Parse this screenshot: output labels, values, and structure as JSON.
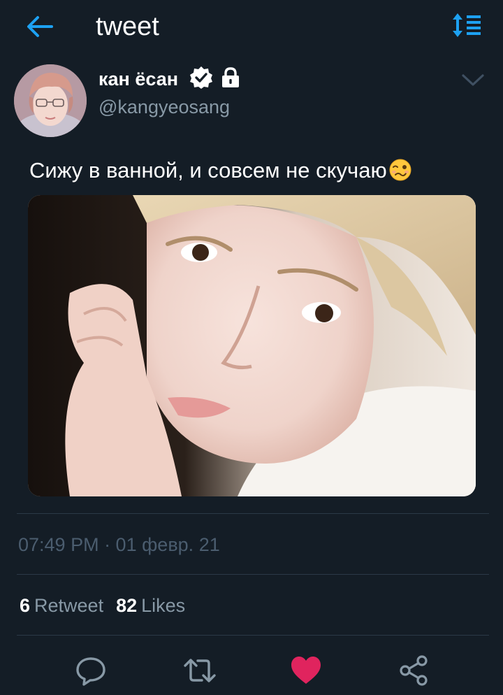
{
  "header": {
    "title": "tweet",
    "back_icon": "arrow-left-icon",
    "sort_icon": "sort-lines-icon",
    "accent": "#1da1f2"
  },
  "author": {
    "name": "кан ёсан",
    "handle": "@kangyeosang",
    "verified_icon": "verified-badge-icon",
    "lock_icon": "lock-icon",
    "menu_icon": "chevron-down-icon"
  },
  "tweet": {
    "text": "Сижу в ванной, и совсем не скучаю",
    "emoji": "woozy-face-emoji",
    "timestamp": "07:49 PM · 01 февр. 21"
  },
  "stats": {
    "retweets": "6",
    "retweets_label": "Retweet",
    "likes": "82",
    "likes_label": "Likes"
  },
  "actions": [
    {
      "name": "reply",
      "icon": "comment-bubble-icon"
    },
    {
      "name": "retweet",
      "icon": "retweet-arrows-icon"
    },
    {
      "name": "like",
      "icon": "heart-icon",
      "active": true,
      "color": "#e0245e"
    },
    {
      "name": "share",
      "icon": "share-nodes-icon"
    }
  ],
  "colors": {
    "background": "#141d26",
    "secondary_text": "#8899a6",
    "divider": "#2b3947",
    "like_active": "#e0245e"
  }
}
